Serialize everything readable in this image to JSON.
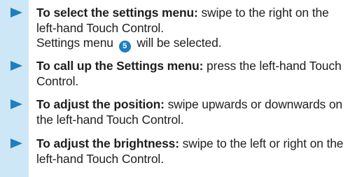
{
  "accent_color": "#1c7fc1",
  "strip_color": "#cde7f6",
  "icons": {
    "step_marker": "triangle-right-icon",
    "number_badge": "numbered-circle-icon"
  },
  "steps": [
    {
      "lead": "To select the settings menu:",
      "body": " swipe to the right on the left-hand Touch Control.",
      "note": {
        "before": "Settings menu ",
        "badge": "5",
        "after": " will be selected."
      }
    },
    {
      "lead": "To call up the Settings menu:",
      "body": " press the left-hand Touch Control."
    },
    {
      "lead": "To adjust the position:",
      "body": " swipe upwards or downwards on the left-hand Touch Control."
    },
    {
      "lead": "To adjust the brightness:",
      "body": " swipe to the left or right on the left-hand Touch Control."
    }
  ]
}
